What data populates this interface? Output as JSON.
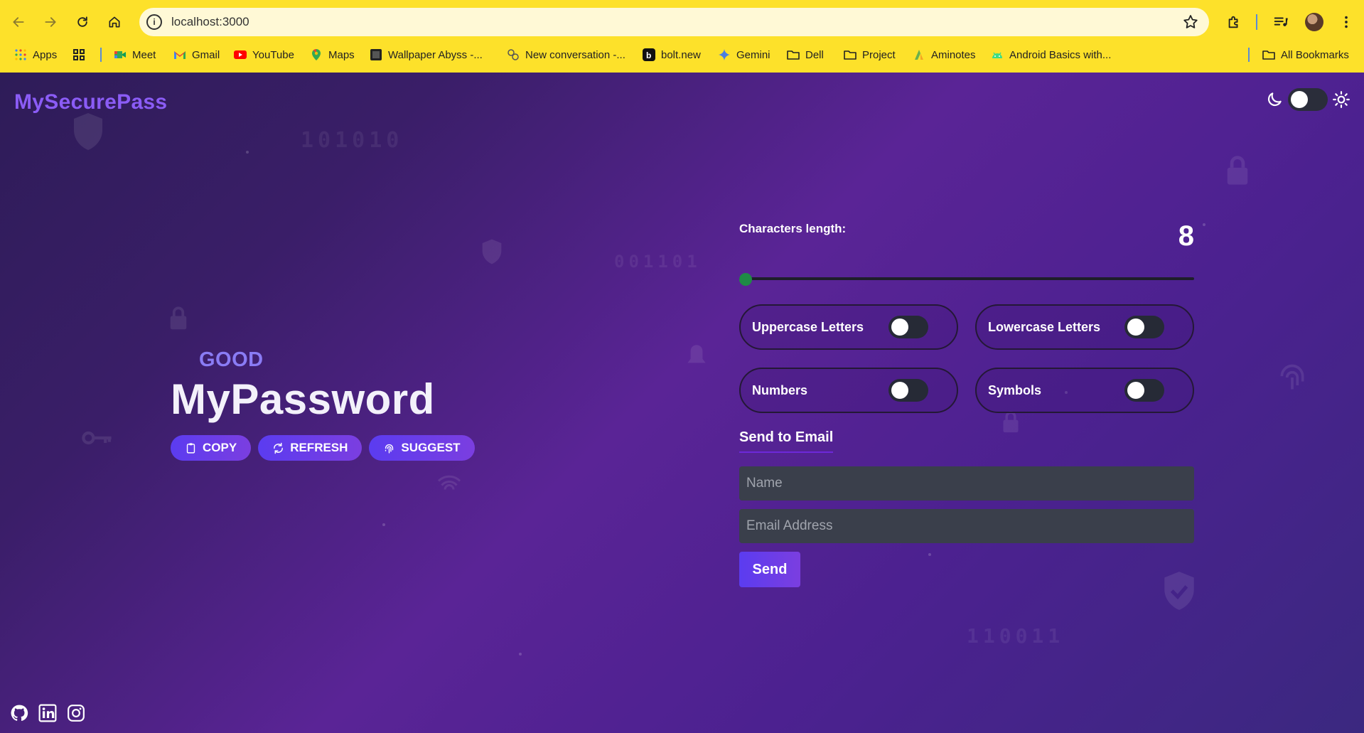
{
  "browser": {
    "url": "localhost:3000",
    "bookmarks": [
      {
        "label": "Apps",
        "icon": "apps-grid-icon"
      },
      {
        "label": "",
        "icon": "grid-squares-icon"
      },
      {
        "label": "Meet",
        "icon": "meet-icon"
      },
      {
        "label": "Gmail",
        "icon": "gmail-icon"
      },
      {
        "label": "YouTube",
        "icon": "youtube-icon"
      },
      {
        "label": "Maps",
        "icon": "maps-pin-icon"
      },
      {
        "label": "Wallpaper Abyss -...",
        "icon": "wallpaper-icon"
      },
      {
        "label": "New conversation -...",
        "icon": "conversation-icon"
      },
      {
        "label": "bolt.new",
        "icon": "bolt-icon"
      },
      {
        "label": "Gemini",
        "icon": "gemini-sparkle-icon"
      },
      {
        "label": "Dell",
        "icon": "folder-icon"
      },
      {
        "label": "Project",
        "icon": "folder-icon"
      },
      {
        "label": "Aminotes",
        "icon": "aminotes-icon"
      },
      {
        "label": "Android Basics with...",
        "icon": "android-icon"
      }
    ],
    "all_bookmarks": "All Bookmarks"
  },
  "app": {
    "brand": "MySecurePass",
    "decorative_binary": [
      "101010",
      "001101",
      "110011"
    ],
    "strength": "GOOD",
    "password": "MyPassword",
    "actions": {
      "copy": "COPY",
      "refresh": "REFRESH",
      "suggest": "SUGGEST"
    },
    "length": {
      "label": "Characters length:",
      "value": "8",
      "slider_fraction": 0
    },
    "options": {
      "uppercase": "Uppercase Letters",
      "lowercase": "Lowercase Letters",
      "numbers": "Numbers",
      "symbols": "Symbols"
    },
    "email": {
      "title": "Send to Email",
      "name_placeholder": "Name",
      "email_placeholder": "Email Address",
      "send": "Send"
    },
    "colors": {
      "brand": "#8b5cf6",
      "accent": "#5b3cf0",
      "chrome": "#fde12a"
    }
  }
}
